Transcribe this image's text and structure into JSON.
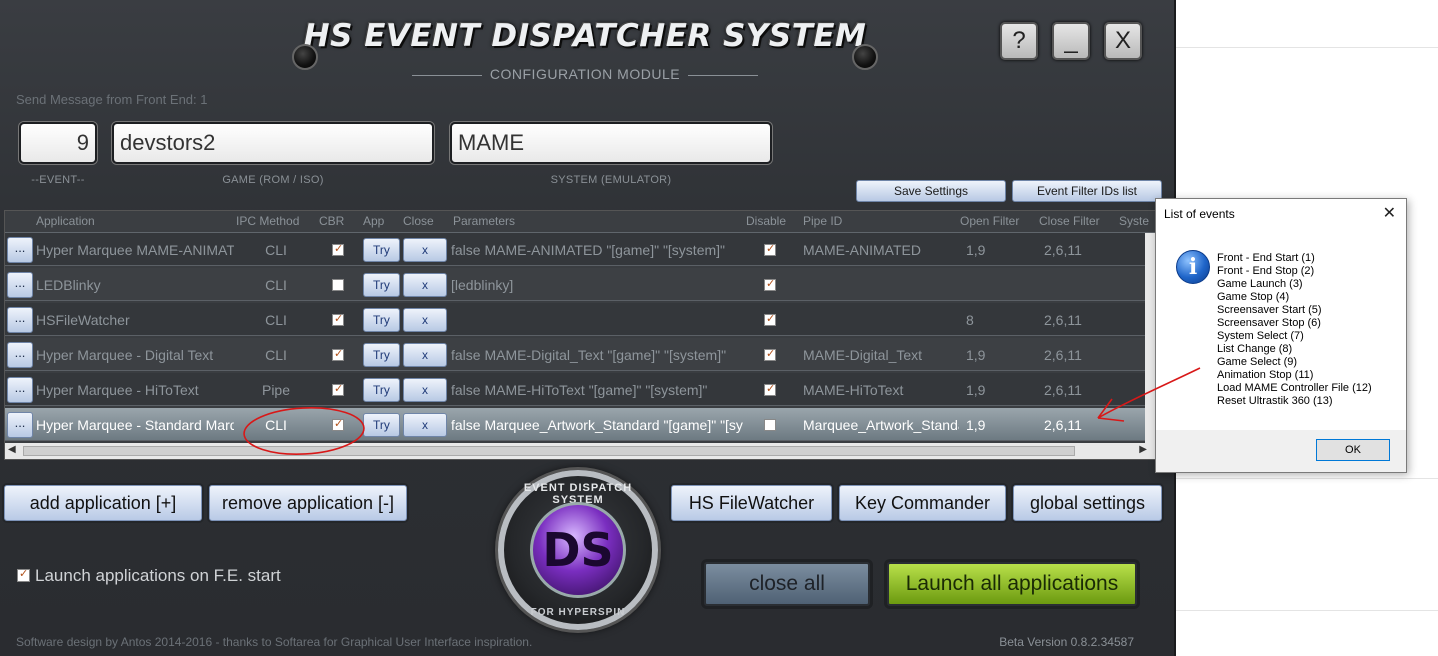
{
  "window": {
    "title": "HS EVENT DISPATCHER SYSTEM",
    "subtitle": "CONFIGURATION MODULE",
    "help_label": "?",
    "minimize_label": "_",
    "close_label": "X"
  },
  "send_message": "Send Message from Front End: 1",
  "fields": {
    "event_value": "9",
    "game_value": "devstors2",
    "system_value": "MAME",
    "event_label": "--EVENT--",
    "game_label": "GAME (ROM / ISO)",
    "system_label": "SYSTEM (EMULATOR)"
  },
  "toolbar": {
    "save_settings": "Save Settings",
    "event_filter_list": "Event Filter IDs list"
  },
  "table": {
    "columns": [
      "Application",
      "IPC Method",
      "CBR",
      "App",
      "Close",
      "Parameters",
      "Disable",
      "Pipe ID",
      "Open Filter",
      "Close Filter",
      "Syste"
    ],
    "row_button": "...",
    "try_label": "Try",
    "close_btn_label": "x",
    "rows": [
      {
        "application": "Hyper Marquee MAME-ANIMATED",
        "ipc": "CLI",
        "cbr": true,
        "parameters": "false MAME-ANIMATED \"[game]\" \"[system]\"",
        "disable": true,
        "pipe_id": "MAME-ANIMATED",
        "open_filter": "1,9",
        "close_filter": "2,6,11"
      },
      {
        "application": "LEDBlinky",
        "ipc": "CLI",
        "cbr": false,
        "parameters": "[ledblinky]",
        "disable": true,
        "pipe_id": "",
        "open_filter": "",
        "close_filter": ""
      },
      {
        "application": "HSFileWatcher",
        "ipc": "CLI",
        "cbr": true,
        "parameters": "",
        "disable": true,
        "pipe_id": "",
        "open_filter": "8",
        "close_filter": "2,6,11"
      },
      {
        "application": "Hyper Marquee - Digital Text",
        "ipc": "CLI",
        "cbr": true,
        "parameters": "false MAME-Digital_Text \"[game]\" \"[system]\"",
        "disable": true,
        "pipe_id": "MAME-Digital_Text",
        "open_filter": "1,9",
        "close_filter": "2,6,11"
      },
      {
        "application": "Hyper Marquee - HiToText",
        "ipc": "Pipe",
        "cbr": true,
        "parameters": "false MAME-HiToText \"[game]\" \"[system]\"",
        "disable": true,
        "pipe_id": "MAME-HiToText",
        "open_filter": "1,9",
        "close_filter": "2,6,11"
      },
      {
        "application": "Hyper Marquee - Standard Marquee",
        "ipc": "CLI",
        "cbr": true,
        "parameters": "false Marquee_Artwork_Standard \"[game]\" \"[system]\"",
        "disable": false,
        "pipe_id": "Marquee_Artwork_Standard",
        "open_filter": "1,9",
        "close_filter": "2,6,11"
      }
    ]
  },
  "buttons": {
    "add_application": "add application [+]",
    "remove_application": "remove application [-]",
    "hs_filewatcher": "HS FileWatcher",
    "key_commander": "Key Commander",
    "global_settings": "global settings",
    "close_all": "close all",
    "launch_all": "Launch all applications"
  },
  "logo": {
    "top_text": "EVENT DISPATCH SYSTEM",
    "center_text": "DS",
    "bottom_text": "FOR HYPERSPIN"
  },
  "launch_on_start": {
    "label": "Launch applications on F.E. start",
    "checked": true
  },
  "footer": {
    "credits": "Software design by Antos 2014-2016 - thanks to Softarea for Graphical User Interface inspiration.",
    "version": "Beta Version 0.8.2.34587"
  },
  "dialog": {
    "title": "List of events",
    "close_label": "✕",
    "icon_glyph": "i",
    "events": [
      "Front - End Start (1)",
      "Front - End Stop (2)",
      "Game Launch (3)",
      "Game Stop (4)",
      "Screensaver Start (5)",
      "Screensaver Stop (6)",
      "System Select (7)",
      "List Change (8)",
      "Game Select (9)",
      "Animation Stop (11)",
      "Load MAME Controller File (12)",
      "Reset Ultrastik 360 (13)"
    ],
    "ok_label": "OK"
  },
  "colors": {
    "accent_blue": "#b8c9e4",
    "launch_green": "#9ccc2a",
    "annotation_red": "#d81818"
  }
}
